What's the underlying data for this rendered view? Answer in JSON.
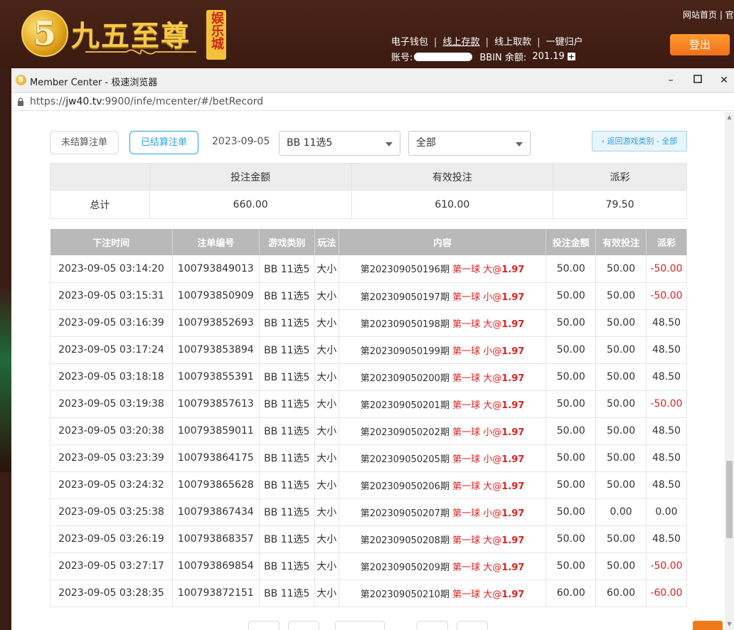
{
  "site": {
    "logo_text": "九五至尊",
    "logo_tag": "娱乐城",
    "links": [
      "电子钱包",
      "线上存款",
      "线上取款",
      "一键归户"
    ],
    "account_label": "账号:",
    "balance_label": "BBIN 余额:",
    "balance": "201.19",
    "home_link": "网站首页 | 官",
    "logout": "登出"
  },
  "browser": {
    "title": "Member Center - 极速浏览器",
    "url_scheme": "https://",
    "url_host": "jw40.tv",
    "url_rest": ":9900/infe/mcenter/#/betRecord"
  },
  "filters": {
    "unsettled": "未结算注单",
    "settled": "已结算注单",
    "date": "2023-09-05",
    "game_select": "BB 11选5",
    "type_select": "全部",
    "back": "‹ 返回游戏类别 - 全部"
  },
  "summary": {
    "headers": [
      "投注金额",
      "有效投注",
      "派彩"
    ],
    "row_label": "总计",
    "values": [
      "660.00",
      "610.00",
      "79.50"
    ]
  },
  "table": {
    "headers": [
      "下注时间",
      "注单编号",
      "游戏类别",
      "玩法",
      "内容",
      "投注金额",
      "有效投注",
      "派彩"
    ],
    "rows": [
      [
        "2023-09-05 03:14:20",
        "100793849013",
        "BB 11选5",
        "大小",
        "第202309050196期",
        "第一球 大@",
        "1.97",
        "50.00",
        "50.00",
        "-50.00"
      ],
      [
        "2023-09-05 03:15:31",
        "100793850909",
        "BB 11选5",
        "大小",
        "第202309050197期",
        "第一球 小@",
        "1.97",
        "50.00",
        "50.00",
        "-50.00"
      ],
      [
        "2023-09-05 03:16:39",
        "100793852693",
        "BB 11选5",
        "大小",
        "第202309050198期",
        "第一球 大@",
        "1.97",
        "50.00",
        "50.00",
        "48.50"
      ],
      [
        "2023-09-05 03:17:24",
        "100793853894",
        "BB 11选5",
        "大小",
        "第202309050199期",
        "第一球 小@",
        "1.97",
        "50.00",
        "50.00",
        "48.50"
      ],
      [
        "2023-09-05 03:18:18",
        "100793855391",
        "BB 11选5",
        "大小",
        "第202309050200期",
        "第一球 大@",
        "1.97",
        "50.00",
        "50.00",
        "48.50"
      ],
      [
        "2023-09-05 03:19:38",
        "100793857613",
        "BB 11选5",
        "大小",
        "第202309050201期",
        "第一球 大@",
        "1.97",
        "50.00",
        "50.00",
        "-50.00"
      ],
      [
        "2023-09-05 03:20:38",
        "100793859011",
        "BB 11选5",
        "大小",
        "第202309050202期",
        "第一球 小@",
        "1.97",
        "50.00",
        "50.00",
        "48.50"
      ],
      [
        "2023-09-05 03:23:39",
        "100793864175",
        "BB 11选5",
        "大小",
        "第202309050205期",
        "第一球 小@",
        "1.97",
        "50.00",
        "50.00",
        "48.50"
      ],
      [
        "2023-09-05 03:24:32",
        "100793865628",
        "BB 11选5",
        "大小",
        "第202309050206期",
        "第一球 大@",
        "1.97",
        "50.00",
        "50.00",
        "48.50"
      ],
      [
        "2023-09-05 03:25:38",
        "100793867434",
        "BB 11选5",
        "大小",
        "第202309050207期",
        "第一球 小@",
        "1.97",
        "50.00",
        "0.00",
        "0.00"
      ],
      [
        "2023-09-05 03:26:19",
        "100793868357",
        "BB 11选5",
        "大小",
        "第202309050208期",
        "第一球 大@",
        "1.97",
        "50.00",
        "50.00",
        "48.50"
      ],
      [
        "2023-09-05 03:27:17",
        "100793869854",
        "BB 11选5",
        "大小",
        "第202309050209期",
        "第一球 大@",
        "1.97",
        "50.00",
        "50.00",
        "-50.00"
      ],
      [
        "2023-09-05 03:28:35",
        "100793872151",
        "BB 11选5",
        "大小",
        "第202309050210期",
        "第一球 大@",
        "1.97",
        "60.00",
        "60.00",
        "-60.00"
      ]
    ]
  }
}
